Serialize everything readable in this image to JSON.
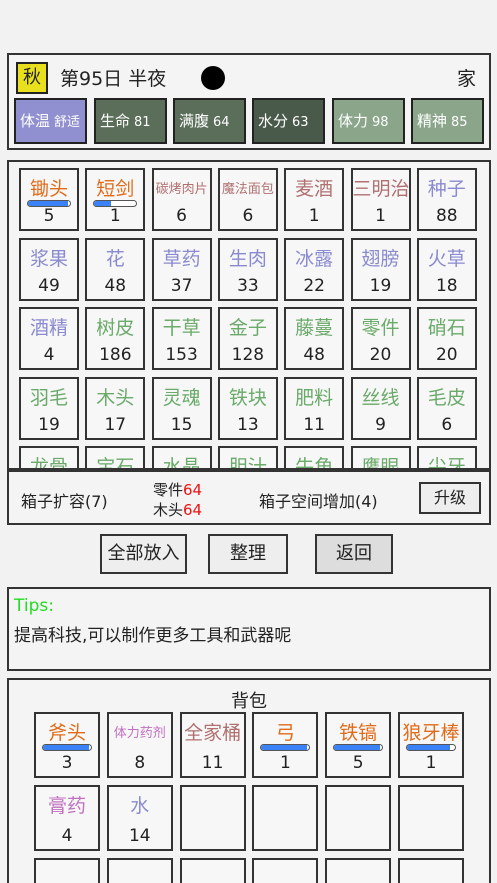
{
  "header": {
    "season": "秋",
    "day": "第95日 半夜",
    "location": "家",
    "stats": [
      {
        "label": "体温",
        "value": "舒适",
        "color": "#9090d0"
      },
      {
        "label": "生命",
        "value": "81",
        "color": "#5a6e5a"
      },
      {
        "label": "满腹",
        "value": "64",
        "color": "#5a6e5a"
      },
      {
        "label": "水分",
        "value": "63",
        "color": "#4a5a4a"
      },
      {
        "label": "体力",
        "value": "98",
        "color": "#8aa58a"
      },
      {
        "label": "精神",
        "value": "85",
        "color": "#8aa58a"
      }
    ]
  },
  "storage": {
    "items": [
      {
        "name": "锄头",
        "count": "5",
        "color": "#e06b1a",
        "durability": 0.95
      },
      {
        "name": "短剑",
        "count": "1",
        "color": "#e06b1a",
        "durability": 0.4
      },
      {
        "name": "碳烤肉片",
        "count": "6",
        "color": "#b07070"
      },
      {
        "name": "魔法面包",
        "count": "6",
        "color": "#b07070"
      },
      {
        "name": "麦酒",
        "count": "1",
        "color": "#b07070"
      },
      {
        "name": "三明治",
        "count": "1",
        "color": "#b07070"
      },
      {
        "name": "种子",
        "count": "88",
        "color": "#8a8ad0"
      },
      {
        "name": "浆果",
        "count": "49",
        "color": "#8a8ad0"
      },
      {
        "name": "花",
        "count": "48",
        "color": "#8a8ad0"
      },
      {
        "name": "草药",
        "count": "37",
        "color": "#8a8ad0"
      },
      {
        "name": "生肉",
        "count": "33",
        "color": "#8a8ad0"
      },
      {
        "name": "冰露",
        "count": "22",
        "color": "#8a8ad0"
      },
      {
        "name": "翅膀",
        "count": "19",
        "color": "#8a8ad0"
      },
      {
        "name": "火草",
        "count": "18",
        "color": "#8a8ad0"
      },
      {
        "name": "酒精",
        "count": "4",
        "color": "#8a8ad0"
      },
      {
        "name": "树皮",
        "count": "186",
        "color": "#6aaa6a"
      },
      {
        "name": "干草",
        "count": "153",
        "color": "#6aaa6a"
      },
      {
        "name": "金子",
        "count": "128",
        "color": "#6aaa6a"
      },
      {
        "name": "藤蔓",
        "count": "48",
        "color": "#6aaa6a"
      },
      {
        "name": "零件",
        "count": "20",
        "color": "#6aaa6a"
      },
      {
        "name": "硝石",
        "count": "20",
        "color": "#6aaa6a"
      },
      {
        "name": "羽毛",
        "count": "19",
        "color": "#6aaa6a"
      },
      {
        "name": "木头",
        "count": "17",
        "color": "#6aaa6a"
      },
      {
        "name": "灵魂",
        "count": "15",
        "color": "#6aaa6a"
      },
      {
        "name": "铁块",
        "count": "13",
        "color": "#6aaa6a"
      },
      {
        "name": "肥料",
        "count": "11",
        "color": "#6aaa6a"
      },
      {
        "name": "丝线",
        "count": "9",
        "color": "#6aaa6a"
      },
      {
        "name": "毛皮",
        "count": "6",
        "color": "#6aaa6a"
      },
      {
        "name": "龙骨",
        "count": "",
        "color": "#6aaa6a"
      },
      {
        "name": "宝石",
        "count": "",
        "color": "#6aaa6a"
      },
      {
        "name": "水晶",
        "count": "",
        "color": "#6aaa6a"
      },
      {
        "name": "胆汁",
        "count": "",
        "color": "#6aaa6a"
      },
      {
        "name": "牛角",
        "count": "",
        "color": "#6aaa6a"
      },
      {
        "name": "鹰眼",
        "count": "",
        "color": "#6aaa6a"
      },
      {
        "name": "尖牙",
        "count": "",
        "color": "#6aaa6a"
      }
    ]
  },
  "expand": {
    "label": "箱子扩容(7)",
    "req1_name": "零件",
    "req1_amount": "64",
    "req2_name": "木头",
    "req2_amount": "64",
    "space_label": "箱子空间增加(4)",
    "upgrade_label": "升级"
  },
  "actions": {
    "put_all": "全部放入",
    "sort": "整理",
    "back": "返回"
  },
  "tips": {
    "heading": "Tips:",
    "text": "提高科技,可以制作更多工具和武器呢"
  },
  "bag": {
    "title": "背包",
    "items": [
      {
        "name": "斧头",
        "count": "3",
        "color": "#e06b1a",
        "durability": 0.95
      },
      {
        "name": "体力药剂",
        "count": "8",
        "color": "#c070c0"
      },
      {
        "name": "全家桶",
        "count": "11",
        "color": "#b07070"
      },
      {
        "name": "弓",
        "count": "1",
        "color": "#e06b1a",
        "durability": 0.95
      },
      {
        "name": "铁镐",
        "count": "5",
        "color": "#e06b1a",
        "durability": 0.95
      },
      {
        "name": "狼牙棒",
        "count": "1",
        "color": "#e06b1a",
        "durability": 0.9
      },
      {
        "name": "膏药",
        "count": "4",
        "color": "#c070c0"
      },
      {
        "name": "水",
        "count": "14",
        "color": "#8a8ad0"
      },
      {
        "name": "",
        "count": ""
      },
      {
        "name": "",
        "count": ""
      },
      {
        "name": "",
        "count": ""
      },
      {
        "name": "",
        "count": ""
      },
      {
        "name": "",
        "count": ""
      },
      {
        "name": "",
        "count": ""
      },
      {
        "name": "",
        "count": ""
      },
      {
        "name": "",
        "count": ""
      },
      {
        "name": "",
        "count": ""
      },
      {
        "name": "",
        "count": ""
      }
    ]
  }
}
